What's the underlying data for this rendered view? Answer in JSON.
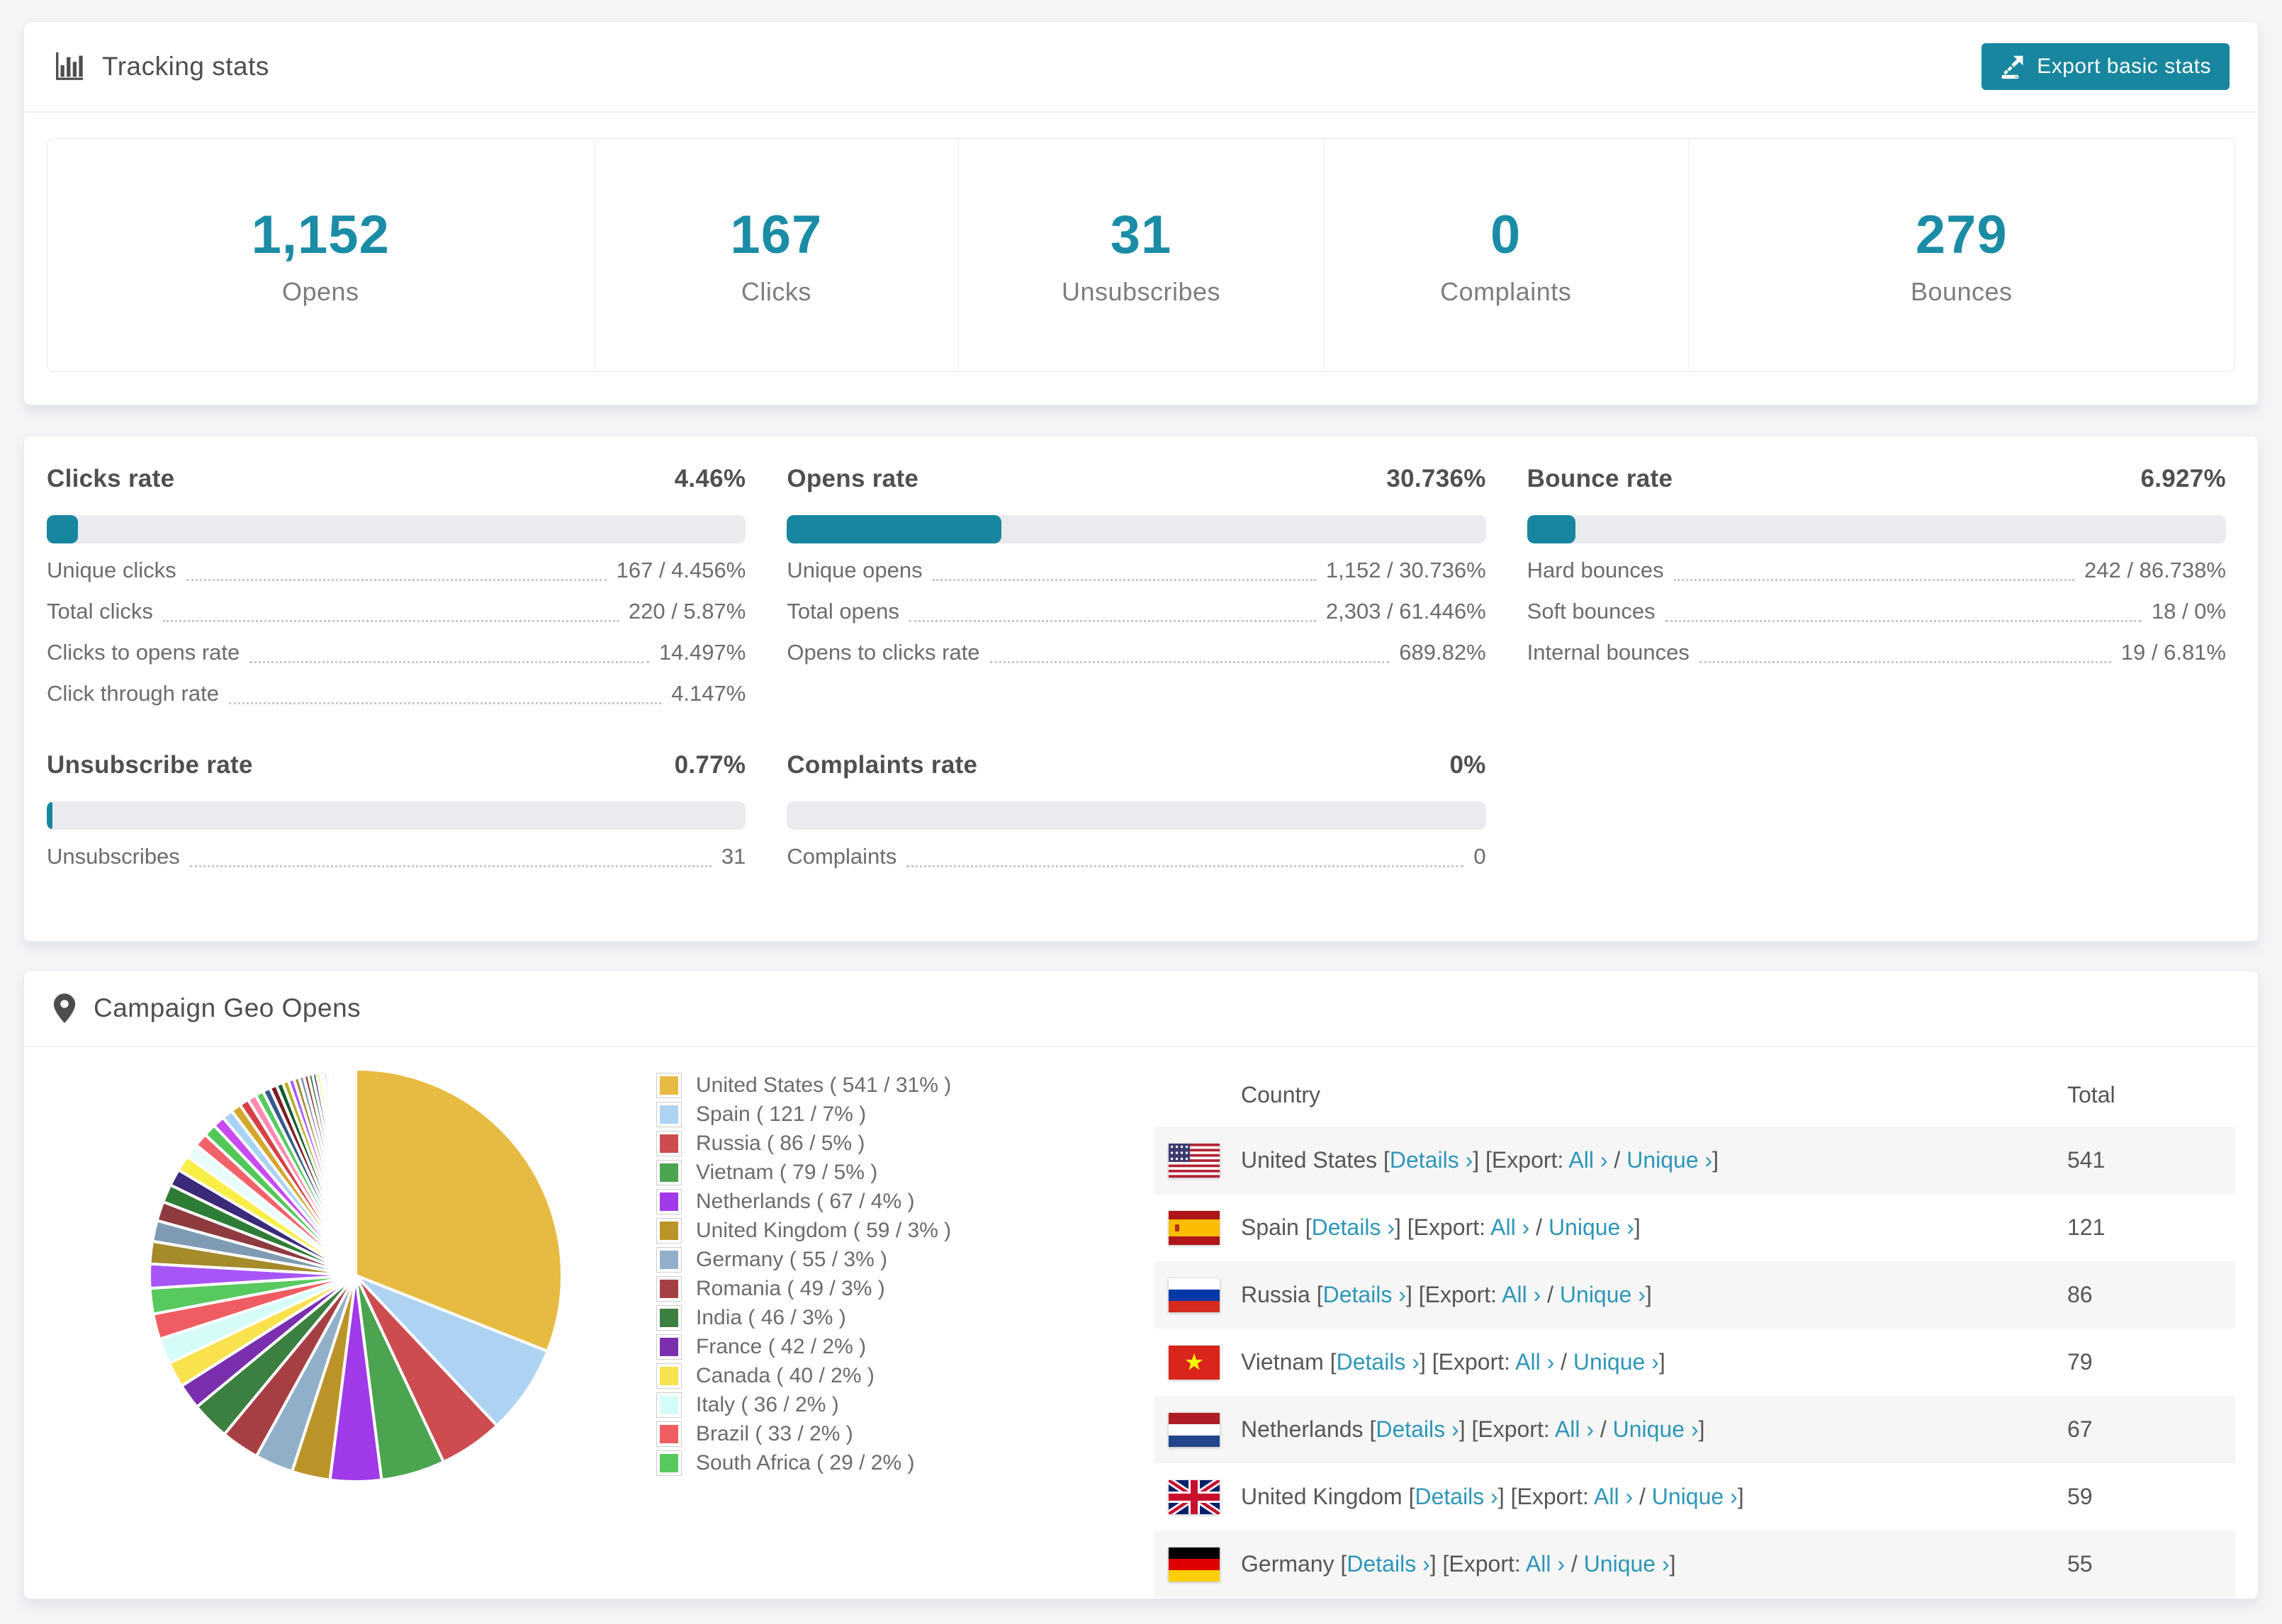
{
  "colors": {
    "accent": "#18869e",
    "stat_number": "#1b8ca6",
    "link": "#2e96b8",
    "bar_track": "#e9ebef",
    "page_background": "#f4f5f7"
  },
  "tracking_stats": {
    "icon": "bar-chart-icon",
    "title": "Tracking stats",
    "export_button": {
      "icon": "export-icon",
      "label": "Export basic stats"
    },
    "summary": [
      {
        "value": "1,152",
        "label": "Opens"
      },
      {
        "value": "167",
        "label": "Clicks"
      },
      {
        "value": "31",
        "label": "Unsubscribes"
      },
      {
        "value": "0",
        "label": "Complaints"
      },
      {
        "value": "279",
        "label": "Bounces"
      }
    ]
  },
  "rates": [
    {
      "title": "Clicks rate",
      "value": "4.46%",
      "percent": 4.46,
      "rows": [
        {
          "label": "Unique clicks",
          "value": "167 / 4.456%"
        },
        {
          "label": "Total clicks",
          "value": "220 / 5.87%"
        },
        {
          "label": "Clicks to opens rate",
          "value": "14.497%"
        },
        {
          "label": "Click through rate",
          "value": "4.147%"
        }
      ]
    },
    {
      "title": "Opens rate",
      "value": "30.736%",
      "percent": 30.736,
      "rows": [
        {
          "label": "Unique opens",
          "value": "1,152 / 30.736%"
        },
        {
          "label": "Total opens",
          "value": "2,303 / 61.446%"
        },
        {
          "label": "Opens to clicks rate",
          "value": "689.82%"
        }
      ]
    },
    {
      "title": "Bounce rate",
      "value": "6.927%",
      "percent": 6.927,
      "rows": [
        {
          "label": "Hard bounces",
          "value": "242 / 86.738%"
        },
        {
          "label": "Soft bounces",
          "value": "18 / 0%"
        },
        {
          "label": "Internal bounces",
          "value": "19 / 6.81%"
        }
      ]
    },
    {
      "title": "Unsubscribe rate",
      "value": "0.77%",
      "percent": 0.77,
      "rows": [
        {
          "label": "Unsubscribes",
          "value": "31"
        }
      ]
    },
    {
      "title": "Complaints rate",
      "value": "0%",
      "percent": 0,
      "rows": [
        {
          "label": "Complaints",
          "value": "0"
        }
      ]
    }
  ],
  "geo": {
    "icon": "map-marker-icon",
    "title": "Campaign Geo Opens",
    "table": {
      "columns": [
        "Country",
        "Total"
      ],
      "link_labels": {
        "details": "Details",
        "export_prefix": "Export:",
        "all": "All",
        "unique": "Unique",
        "chevron": "›"
      },
      "rows": [
        {
          "country": "United States",
          "flag": "us",
          "total": "541"
        },
        {
          "country": "Spain",
          "flag": "es",
          "total": "121"
        },
        {
          "country": "Russia",
          "flag": "ru",
          "total": "86"
        },
        {
          "country": "Vietnam",
          "flag": "vn",
          "total": "79"
        },
        {
          "country": "Netherlands",
          "flag": "nl",
          "total": "67"
        },
        {
          "country": "United Kingdom",
          "flag": "gb",
          "total": "59"
        },
        {
          "country": "Germany",
          "flag": "de",
          "total": "55"
        }
      ]
    }
  },
  "chart_data": {
    "type": "pie",
    "title": "Campaign Geo Opens",
    "unit": "opens",
    "legend_position": "right",
    "start_angle": "top",
    "direction": "clockwise",
    "labels": [
      "United States",
      "Spain",
      "Russia",
      "Vietnam",
      "Netherlands",
      "United Kingdom",
      "Germany",
      "Romania",
      "India",
      "France",
      "Canada",
      "Italy",
      "Brazil",
      "South Africa"
    ],
    "values": [
      541,
      121,
      86,
      79,
      67,
      59,
      55,
      49,
      46,
      42,
      40,
      36,
      33,
      29
    ],
    "percents": [
      31,
      7,
      5,
      5,
      4,
      3,
      3,
      3,
      3,
      2,
      2,
      2,
      2,
      2
    ],
    "colors": [
      "#e7bb41",
      "#aed3f2",
      "#cc4c50",
      "#4ba44f",
      "#a13ae8",
      "#bb9429",
      "#92afc9",
      "#a63f44",
      "#3b7f41",
      "#7a2fae",
      "#fae14e",
      "#d6fcfa",
      "#ef5d63",
      "#58c95f"
    ],
    "unlabeled_remainder_pct": 26,
    "extra_slice_colors": [
      "#a855f7",
      "#a58b2a",
      "#7f9bb3",
      "#8e3a3f",
      "#2e7d36",
      "#3b2a7a",
      "#f7ef46",
      "#e8fdfb",
      "#f2626b",
      "#52c75a",
      "#c84af0",
      "#a9d3f5",
      "#d4a72c",
      "#d64045",
      "#ff8ab0",
      "#58c95f",
      "#345b8c",
      "#7a1f24",
      "#145a32",
      "#b5b02a"
    ]
  }
}
